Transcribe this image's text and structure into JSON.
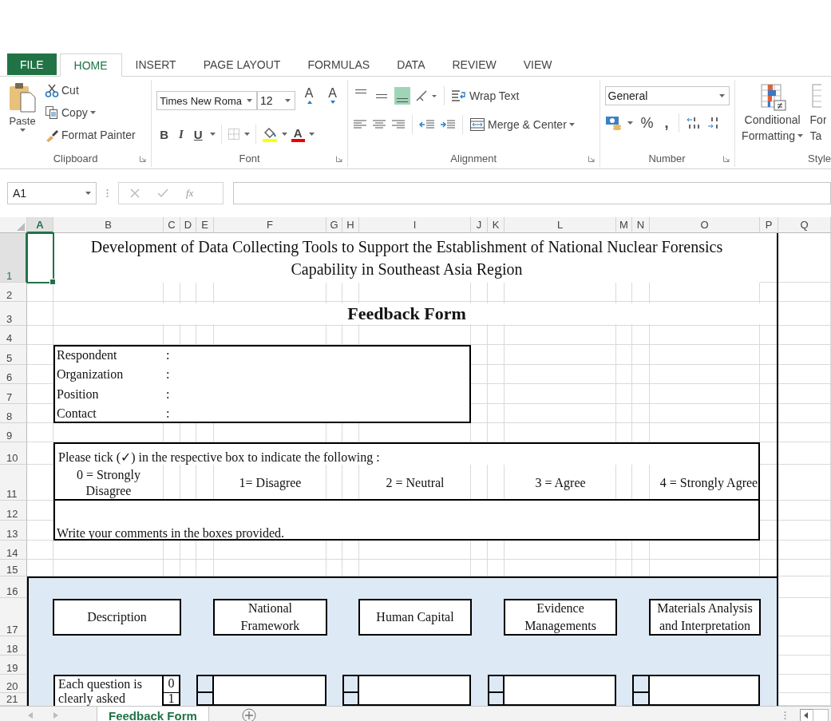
{
  "ribbon_tabs": [
    {
      "label": "FILE",
      "kind": "file",
      "selected": false
    },
    {
      "label": "HOME",
      "kind": "tab",
      "selected": true
    },
    {
      "label": "INSERT",
      "kind": "tab",
      "selected": false
    },
    {
      "label": "PAGE LAYOUT",
      "kind": "tab",
      "selected": false
    },
    {
      "label": "FORMULAS",
      "kind": "tab",
      "selected": false
    },
    {
      "label": "DATA",
      "kind": "tab",
      "selected": false
    },
    {
      "label": "REVIEW",
      "kind": "tab",
      "selected": false
    },
    {
      "label": "VIEW",
      "kind": "tab",
      "selected": false
    }
  ],
  "clipboard": {
    "paste": "Paste",
    "cut": "Cut",
    "copy": "Copy",
    "format_painter": "Format Painter",
    "group_label": "Clipboard"
  },
  "font": {
    "name": "Times New Roma",
    "size": "12",
    "grow": "A",
    "shrink": "A",
    "bold": "B",
    "italic": "I",
    "underline": "U",
    "font_color": "A",
    "group_label": "Font"
  },
  "alignment": {
    "vertical": [
      {
        "selected": false
      },
      {
        "selected": false
      },
      {
        "selected": true
      }
    ],
    "wrap_text": "Wrap Text",
    "merge": "Merge & Center",
    "group_label": "Alignment"
  },
  "number": {
    "format": "General",
    "percent": "%",
    "comma": ",",
    "group_label": "Number"
  },
  "styles": {
    "conditional": [
      "Conditional",
      "Formatting"
    ],
    "format_table": [
      "For",
      "Ta"
    ],
    "group_label": "Style"
  },
  "formula_bar": {
    "name_box": "A1",
    "function_label": "fx"
  },
  "columns": [
    {
      "label": "A",
      "selected": true
    },
    {
      "label": "B",
      "selected": false
    },
    {
      "label": "C",
      "selected": false
    },
    {
      "label": "D",
      "selected": false
    },
    {
      "label": "E",
      "selected": false
    },
    {
      "label": "F",
      "selected": false
    },
    {
      "label": "G",
      "selected": false
    },
    {
      "label": "H",
      "selected": false
    },
    {
      "label": "I",
      "selected": false
    },
    {
      "label": "J",
      "selected": false
    },
    {
      "label": "K",
      "selected": false
    },
    {
      "label": "L",
      "selected": false
    },
    {
      "label": "M",
      "selected": false
    },
    {
      "label": "N",
      "selected": false
    },
    {
      "label": "O",
      "selected": false
    },
    {
      "label": "P",
      "selected": false
    },
    {
      "label": "Q",
      "selected": false
    }
  ],
  "rows": [
    {
      "label": "1",
      "selected": true
    },
    {
      "label": "2",
      "selected": false
    },
    {
      "label": "3",
      "selected": false
    },
    {
      "label": "4",
      "selected": false
    },
    {
      "label": "5",
      "selected": false
    },
    {
      "label": "6",
      "selected": false
    },
    {
      "label": "7",
      "selected": false
    },
    {
      "label": "8",
      "selected": false
    },
    {
      "label": "9",
      "selected": false
    },
    {
      "label": "10",
      "selected": false
    },
    {
      "label": "11",
      "selected": false
    },
    {
      "label": "12",
      "selected": false
    },
    {
      "label": "13",
      "selected": false
    },
    {
      "label": "14",
      "selected": false
    },
    {
      "label": "15",
      "selected": false
    },
    {
      "label": "16",
      "selected": false
    },
    {
      "label": "17",
      "selected": false
    },
    {
      "label": "18",
      "selected": false
    },
    {
      "label": "19",
      "selected": false
    },
    {
      "label": "20",
      "selected": false
    },
    {
      "label": "21",
      "selected": false
    }
  ],
  "sheet": {
    "title": "Development of Data Collecting Tools to Support the Establishment of National Nuclear Forensics Capability in Southeast Asia Region",
    "form_title": "Feedback Form",
    "respondent_fields": [
      {
        "label": "Respondent",
        "separator": ":"
      },
      {
        "label": "Organization",
        "separator": ":"
      },
      {
        "label": "Position",
        "separator": ":"
      },
      {
        "label": "Contact",
        "separator": ":"
      }
    ],
    "instruction": "Please tick (✓) in the respective box to indicate the following :",
    "scale": [
      "0 = Strongly Disagree",
      "1= Disagree",
      "2 = Neutral",
      "3 = Agree",
      "4 = Strongly Agree"
    ],
    "comment_note": "Write your comments in the boxes provided.",
    "categories": [
      "Description",
      "National Framework",
      "Human Capital",
      "Evidence Managements",
      "Materials Analysis and Interpretation"
    ],
    "question": {
      "text": "Each question is clearly asked",
      "options": [
        "0",
        "1"
      ]
    }
  },
  "sheet_tabs": [
    {
      "label": "Feedback Form",
      "selected": true
    }
  ]
}
